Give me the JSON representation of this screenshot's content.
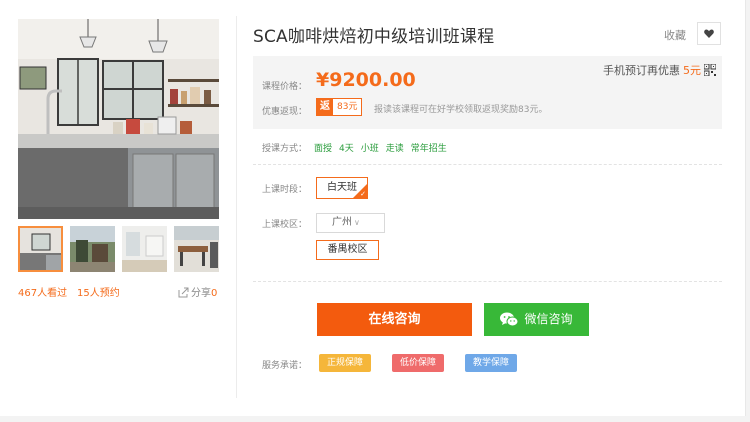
{
  "course": {
    "title": "SCA咖啡烘焙初中级培训班课程",
    "favorite_label": "收藏"
  },
  "stats": {
    "views": "467人看过",
    "bookings": "15人预约",
    "share_label": "分享",
    "share_count": "0"
  },
  "price": {
    "mobile_promo_prefix": "手机预订再优惠",
    "mobile_promo_amount": "5元",
    "price_label": "课程价格：",
    "price_value": "¥9200.00",
    "rebate_label": "优惠返现：",
    "rebate_tag": "返",
    "rebate_amount": "83元",
    "rebate_text": "报读该课程可在好学校领取返现奖励83元。"
  },
  "mode": {
    "label": "授课方式：",
    "options": [
      "面授",
      "4天",
      "小班",
      "走读",
      "常年招生"
    ]
  },
  "schedule": {
    "session_label": "上课时段：",
    "session_value": "白天班",
    "campus_label": "上课校区：",
    "city_value": "广州",
    "campus_value": "番禺校区"
  },
  "actions": {
    "consult_label": "在线咨询",
    "wechat_label": "微信咨询"
  },
  "promise": {
    "label": "服务承诺：",
    "badges": [
      {
        "label": "正规保障",
        "color": "#f5b63a"
      },
      {
        "label": "低价保障",
        "color": "#ef6b6b"
      },
      {
        "label": "教学保障",
        "color": "#6fa8e8"
      }
    ]
  },
  "colors": {
    "accent": "#f46b1b",
    "consult_bg": "#f35b0e",
    "wechat_bg": "#38b838",
    "mode_option": "#2a9c3c"
  }
}
